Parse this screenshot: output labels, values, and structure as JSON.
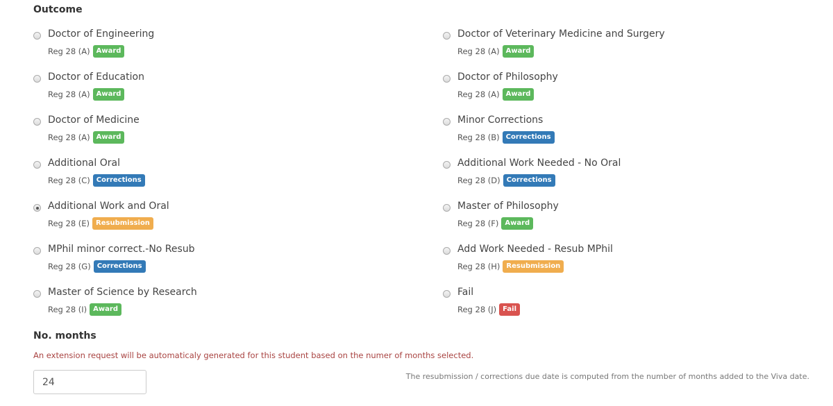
{
  "title": "Outcome",
  "colors": {
    "Award": "#5cb85c",
    "Corrections": "#337ab7",
    "Resubmission": "#f0ad4e",
    "Fail": "#d9534f"
  },
  "options": [
    {
      "label": "Doctor of Engineering",
      "reg": "Reg 28 (A)",
      "badge": "Award",
      "checked": false
    },
    {
      "label": "Doctor of Veterinary Medicine and Surgery",
      "reg": "Reg 28 (A)",
      "badge": "Award",
      "checked": false
    },
    {
      "label": "Doctor of Education",
      "reg": "Reg 28 (A)",
      "badge": "Award",
      "checked": false
    },
    {
      "label": "Doctor of Philosophy",
      "reg": "Reg 28 (A)",
      "badge": "Award",
      "checked": false
    },
    {
      "label": "Doctor of Medicine",
      "reg": "Reg 28 (A)",
      "badge": "Award",
      "checked": false
    },
    {
      "label": "Minor Corrections",
      "reg": "Reg 28 (B)",
      "badge": "Corrections",
      "checked": false
    },
    {
      "label": "Additional Oral",
      "reg": "Reg 28 (C)",
      "badge": "Corrections",
      "checked": false
    },
    {
      "label": "Additional Work Needed - No Oral",
      "reg": "Reg 28 (D)",
      "badge": "Corrections",
      "checked": false
    },
    {
      "label": "Additional Work and Oral",
      "reg": "Reg 28 (E)",
      "badge": "Resubmission",
      "checked": true
    },
    {
      "label": "Master of Philosophy",
      "reg": "Reg 28 (F)",
      "badge": "Award",
      "checked": false
    },
    {
      "label": "MPhil minor correct.-No Resub",
      "reg": "Reg 28 (G)",
      "badge": "Corrections",
      "checked": false
    },
    {
      "label": "Add Work Needed - Resub MPhil",
      "reg": "Reg 28 (H)",
      "badge": "Resubmission",
      "checked": false
    },
    {
      "label": "Master of Science by Research",
      "reg": "Reg 28 (I)",
      "badge": "Award",
      "checked": false
    },
    {
      "label": "Fail",
      "reg": "Reg 28 (J)",
      "badge": "Fail",
      "checked": false
    }
  ],
  "months": {
    "label": "No. months",
    "warning": "An extension request will be automaticaly generated for this student based on the numer of months selected.",
    "value": "24",
    "help": "The resubmission / corrections due date is computed from the number of months added to the Viva date."
  }
}
